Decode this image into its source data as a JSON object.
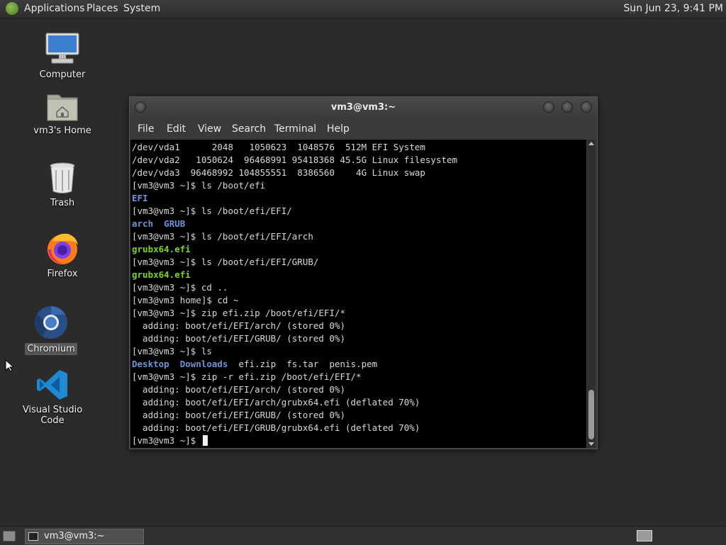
{
  "top_panel": {
    "menus": [
      "Applications",
      "Places",
      "System"
    ],
    "clock": "Sun Jun 23,  9:41 PM"
  },
  "desktop": {
    "icons": [
      {
        "label": "Computer",
        "icon": "computer-icon"
      },
      {
        "label": "vm3's Home",
        "icon": "home-folder-icon"
      },
      {
        "label": "Trash",
        "icon": "trash-icon"
      },
      {
        "label": "Firefox",
        "icon": "firefox-icon"
      },
      {
        "label": "Chromium",
        "icon": "chromium-icon",
        "selected": true
      },
      {
        "label": "Visual Studio Code",
        "icon": "vscode-icon"
      }
    ]
  },
  "terminal": {
    "title": "vm3@vm3:~",
    "menu": [
      "File",
      "Edit",
      "View",
      "Search",
      "Terminal",
      "Help"
    ],
    "lines": [
      [
        {
          "t": "/dev/vda1      2048   1050623  1048576  512M EFI System"
        }
      ],
      [
        {
          "t": "/dev/vda2   1050624  96468991 95418368 45.5G Linux filesystem"
        }
      ],
      [
        {
          "t": "/dev/vda3  96468992 104855551  8386560    4G Linux swap"
        }
      ],
      [
        {
          "t": "[vm3@vm3 ~]$ ls /boot/efi"
        }
      ],
      [
        {
          "t": "EFI",
          "c": "dir"
        }
      ],
      [
        {
          "t": "[vm3@vm3 ~]$ ls /boot/efi/EFI/"
        }
      ],
      [
        {
          "t": "arch",
          "c": "dir"
        },
        {
          "t": "  "
        },
        {
          "t": "GRUB",
          "c": "dir"
        }
      ],
      [
        {
          "t": "[vm3@vm3 ~]$ ls /boot/efi/EFI/arch"
        }
      ],
      [
        {
          "t": "grubx64.efi",
          "c": "exe"
        }
      ],
      [
        {
          "t": "[vm3@vm3 ~]$ ls /boot/efi/EFI/GRUB/"
        }
      ],
      [
        {
          "t": "grubx64.efi",
          "c": "exe"
        }
      ],
      [
        {
          "t": "[vm3@vm3 ~]$ cd .."
        }
      ],
      [
        {
          "t": "[vm3@vm3 home]$ cd ~"
        }
      ],
      [
        {
          "t": "[vm3@vm3 ~]$ zip efi.zip /boot/efi/EFI/*"
        }
      ],
      [
        {
          "t": "  adding: boot/efi/EFI/arch/ (stored 0%)"
        }
      ],
      [
        {
          "t": "  adding: boot/efi/EFI/GRUB/ (stored 0%)"
        }
      ],
      [
        {
          "t": "[vm3@vm3 ~]$ ls"
        }
      ],
      [
        {
          "t": "Desktop",
          "c": "dir"
        },
        {
          "t": "  "
        },
        {
          "t": "Downloads",
          "c": "dir"
        },
        {
          "t": "  efi.zip  fs.tar  penis.pem"
        }
      ],
      [
        {
          "t": "[vm3@vm3 ~]$ zip -r efi.zip /boot/efi/EFI/*"
        }
      ],
      [
        {
          "t": "  adding: boot/efi/EFI/arch/ (stored 0%)"
        }
      ],
      [
        {
          "t": "  adding: boot/efi/EFI/arch/grubx64.efi (deflated 70%)"
        }
      ],
      [
        {
          "t": "  adding: boot/efi/EFI/GRUB/ (stored 0%)"
        }
      ],
      [
        {
          "t": "  adding: boot/efi/EFI/GRUB/grubx64.efi (deflated 70%)"
        }
      ],
      [
        {
          "t": "[vm3@vm3 ~]$ "
        },
        {
          "cursor": true
        }
      ]
    ]
  },
  "bottom_panel": {
    "task": "vm3@vm3:~"
  }
}
